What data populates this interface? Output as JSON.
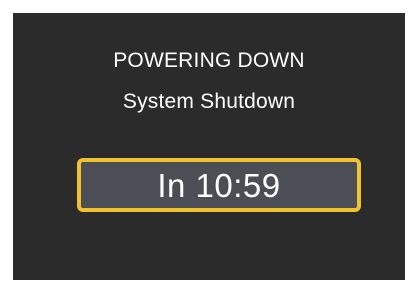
{
  "screen": {
    "title": "POWERING DOWN",
    "subtitle": "System Shutdown",
    "countdown": "In 10:59"
  },
  "colors": {
    "background": "#2b2b2b",
    "text": "#ffffff",
    "countdown_border": "#f2c12e",
    "countdown_fill": "#4b4f55"
  }
}
